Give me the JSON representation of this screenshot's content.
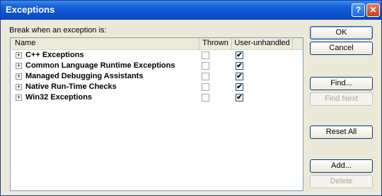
{
  "window": {
    "title": "Exceptions"
  },
  "titlebar": {
    "help_label": "?",
    "close_label": "✕"
  },
  "label": "Break when an exception is:",
  "columns": {
    "name": "Name",
    "thrown": "Thrown",
    "user_unhandled": "User-unhandled"
  },
  "rows": [
    {
      "label": "C++ Exceptions",
      "thrown": false,
      "user_unhandled": true
    },
    {
      "label": "Common Language Runtime Exceptions",
      "thrown": false,
      "user_unhandled": true
    },
    {
      "label": "Managed Debugging Assistants",
      "thrown": false,
      "user_unhandled": true
    },
    {
      "label": "Native Run-Time Checks",
      "thrown": false,
      "user_unhandled": true
    },
    {
      "label": "Win32 Exceptions",
      "thrown": false,
      "user_unhandled": true
    }
  ],
  "buttons": {
    "ok": "OK",
    "cancel": "Cancel",
    "find": "Find...",
    "find_next": "Find Next",
    "reset_all": "Reset All",
    "add": "Add...",
    "delete": "Delete"
  },
  "glyphs": {
    "expand": "+",
    "check": "✔"
  },
  "colors": {
    "titlebar": "#0a52cc",
    "window_bg": "#ece9d8"
  }
}
